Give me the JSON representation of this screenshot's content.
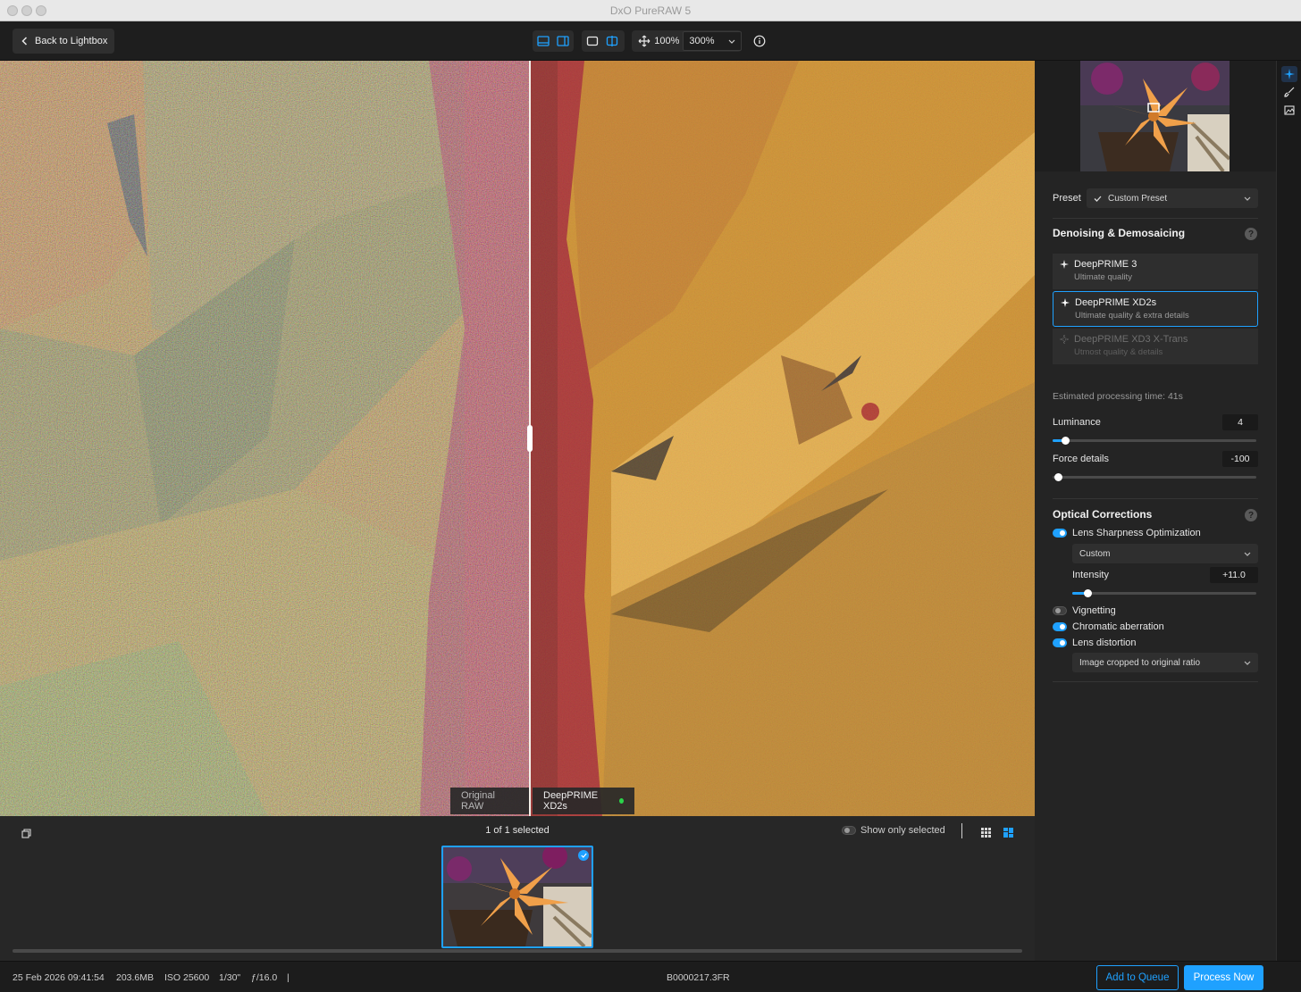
{
  "window": {
    "title": "DxO PureRAW 5"
  },
  "toolbar": {
    "back_label": "Back to Lightbox",
    "zoom_fit": "100%",
    "zoom_level": "300%"
  },
  "viewer": {
    "left_tag": "Original RAW",
    "right_tag": "DeepPRIME XD2s"
  },
  "sidebar": {
    "preset_label": "Preset",
    "preset_value": "Custom Preset",
    "denoise": {
      "title": "Denoising & Demosaicing",
      "help": "?",
      "engines": [
        {
          "name": "DeepPRIME 3",
          "sub": "Ultimate quality",
          "selected": false,
          "enabled": true
        },
        {
          "name": "DeepPRIME XD2s",
          "sub": "Ultimate quality & extra details",
          "selected": true,
          "enabled": true
        },
        {
          "name": "DeepPRIME XD3 X-Trans",
          "sub": "Utmost quality & details",
          "selected": false,
          "enabled": false
        }
      ],
      "estimate": "Estimated processing time:  41s",
      "luminance_label": "Luminance",
      "luminance_value": "4",
      "force_details_label": "Force details",
      "force_details_value": "-100"
    },
    "optical": {
      "title": "Optical Corrections",
      "help": "?",
      "lens_sharpness_label": "Lens Sharpness Optimization",
      "lens_sharpness_on": true,
      "lens_sharpness_mode": "Custom",
      "intensity_label": "Intensity",
      "intensity_value": "+11.0",
      "vignetting_label": "Vignetting",
      "vignetting_on": false,
      "chromatic_label": "Chromatic aberration",
      "chromatic_on": true,
      "distortion_label": "Lens distortion",
      "distortion_on": true,
      "distortion_mode": "Image cropped to original ratio"
    }
  },
  "filmstrip": {
    "selection_count": "1 of 1 selected",
    "show_only_selected": "Show only selected"
  },
  "status": {
    "date": "25 Feb 2026 09:41:54",
    "size": "203.6MB",
    "iso": "ISO 25600",
    "shutter": "1/30\"",
    "aperture": "ƒ/16.0",
    "separator": "|",
    "filename": "B0000217.3FR",
    "add_queue": "Add to Queue",
    "process_now": "Process Now"
  },
  "colors": {
    "accent": "#1fa1ff",
    "panel": "#242424",
    "status_dot": "#2bd44a"
  }
}
